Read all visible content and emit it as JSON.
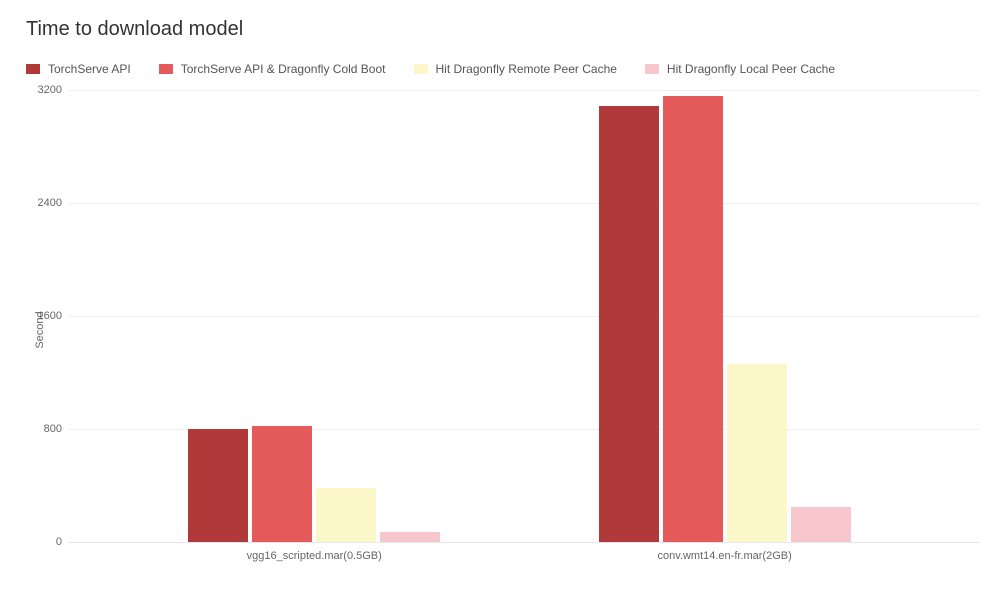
{
  "title": "Time to download model",
  "ylabel": "Second",
  "legend": [
    {
      "name": "TorchServe API",
      "color": "#b03a3a"
    },
    {
      "name": "TorchServe API & Dragonfly Cold Boot",
      "color": "#e55a5a"
    },
    {
      "name": "Hit Dragonfly Remote Peer Cache",
      "color": "#fbf7c8"
    },
    {
      "name": "Hit Dragonfly Local Peer Cache",
      "color": "#f8c7cd"
    }
  ],
  "yticks": [
    0,
    800,
    1600,
    2400,
    3200
  ],
  "xcats": [
    "vgg16_scripted.mar(0.5GB)",
    "conv.wmt14.en-fr.mar(2GB)"
  ],
  "chart_data": {
    "type": "bar",
    "title": "Time to download model",
    "xlabel": "",
    "ylabel": "Second",
    "ylim": [
      0,
      3200
    ],
    "categories": [
      "vgg16_scripted.mar(0.5GB)",
      "conv.wmt14.en-fr.mar(2GB)"
    ],
    "series": [
      {
        "name": "TorchServe API",
        "color": "#b03a3a",
        "values": [
          800,
          3090
        ]
      },
      {
        "name": "TorchServe API & Dragonfly Cold Boot",
        "color": "#e55a5a",
        "values": [
          820,
          3160
        ]
      },
      {
        "name": "Hit Dragonfly Remote Peer Cache",
        "color": "#fbf7c8",
        "values": [
          380,
          1260
        ]
      },
      {
        "name": "Hit Dragonfly Local Peer Cache",
        "color": "#f8c7cd",
        "values": [
          70,
          250
        ]
      }
    ]
  }
}
